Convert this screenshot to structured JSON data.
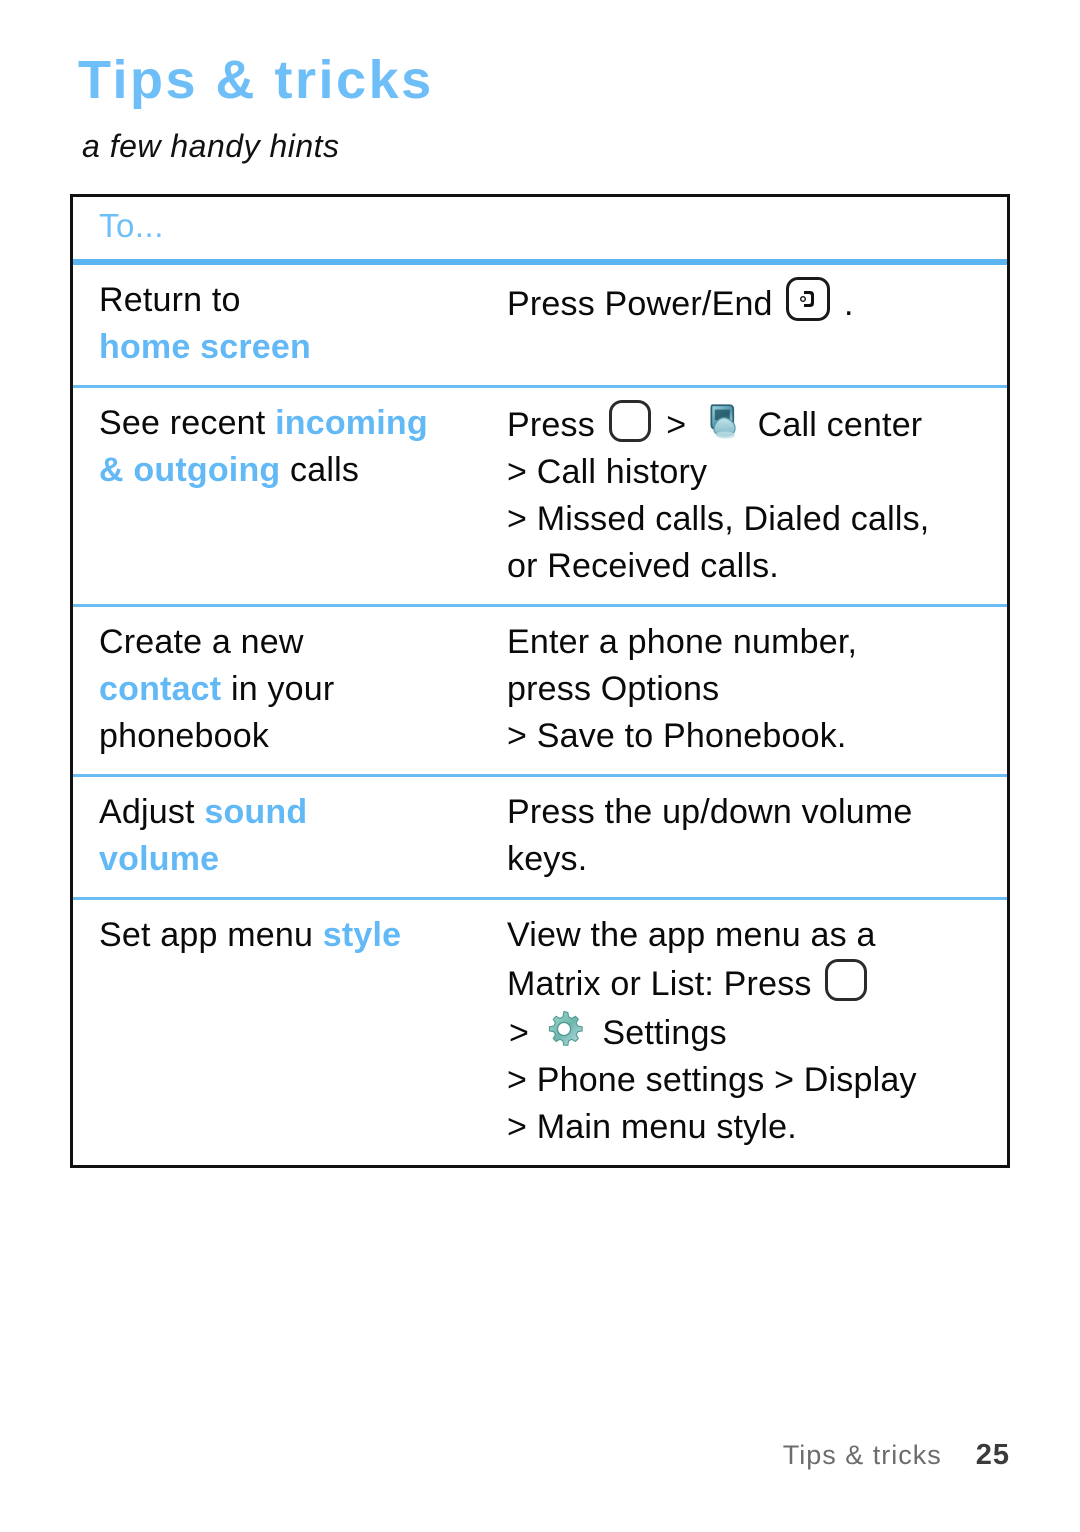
{
  "header": {
    "title": "Tips & tricks",
    "subtitle": "a few handy hints"
  },
  "table": {
    "column_header": "To...",
    "rows": [
      {
        "task": {
          "prefix": "Return to",
          "highlight": "home screen",
          "suffix": ""
        },
        "steps": [
          {
            "pre": "Press Power/End",
            "icon": "power-end-key-icon",
            "post": "."
          }
        ]
      },
      {
        "task": {
          "prefix": "See recent",
          "highlight": "incoming & outgoing",
          "suffix": "calls"
        },
        "steps": [
          {
            "pre": "Press",
            "icon": "center-select-key-icon",
            "mid": ">",
            "icon2": "call-center-icon",
            "post": "Call center"
          },
          {
            "pre": "> Call history"
          },
          {
            "pre": "> Missed calls, Dialed calls,"
          },
          {
            "pre": "or Received calls."
          }
        ]
      },
      {
        "task": {
          "prefix": "Create a new",
          "highlight": "contact",
          "suffix": "in your phonebook"
        },
        "steps": [
          {
            "pre": "Enter a phone number,"
          },
          {
            "pre": "press Options"
          },
          {
            "pre": "> Save to Phonebook."
          }
        ]
      },
      {
        "task": {
          "prefix": "Adjust",
          "highlight": "sound volume",
          "suffix": ""
        },
        "steps": [
          {
            "pre": "Press the up/down volume"
          },
          {
            "pre": "keys."
          }
        ]
      },
      {
        "task": {
          "prefix": "Set app menu",
          "highlight": "style",
          "suffix": ""
        },
        "steps": [
          {
            "pre": "View the app menu as a"
          },
          {
            "pre": "Matrix or List: Press",
            "icon": "center-select-key-icon"
          },
          {
            "pre": ">",
            "icon": "settings-gear-icon",
            "post": "Settings"
          },
          {
            "pre": "> Phone settings > Display"
          },
          {
            "pre": "> Main menu style."
          }
        ]
      }
    ]
  },
  "footer": {
    "section": "Tips & tricks",
    "page_number": "25"
  },
  "colors": {
    "accent_blue": "#62b9f6",
    "title_blue": "#6ebef7",
    "rule_blue": "#5bb5f0",
    "text_black": "#0a0a0a",
    "footer_gray": "#6c6c6c"
  },
  "text_fragments": {
    "row1_task_line1": "Return to",
    "row1_task_line2": "home screen",
    "row1_step1_pre": "Press Power/End",
    "row1_step1_post": ".",
    "row2_task_line1_pre": "See recent",
    "row2_task_line1_hl": "incoming",
    "row2_task_line2_hl": "& outgoing",
    "row2_task_line2_post": "calls",
    "row2_step1_pre": "Press",
    "row2_step1_gt": ">",
    "row2_step1_post": "Call center",
    "row2_step2": "> Call history",
    "row2_step3": "> Missed calls, Dialed calls,",
    "row2_step4": "or Received calls.",
    "row3_task_line1": "Create a new",
    "row3_task_line2_hl": "contact",
    "row3_task_line2_post": "in your",
    "row3_task_line3": "phonebook",
    "row3_step1": "Enter a phone number,",
    "row3_step2": "press Options",
    "row3_step3": "> Save to Phonebook.",
    "row4_task_line1_pre": "Adjust",
    "row4_task_line1_hl": "sound",
    "row4_task_line2_hl": "volume",
    "row4_step1": "Press the up/down volume",
    "row4_step2": "keys.",
    "row5_task_pre": "Set app menu",
    "row5_task_hl": "style",
    "row5_step1": "View the app menu as a",
    "row5_step2_pre": "Matrix or List: Press",
    "row5_step3_gt": ">",
    "row5_step3_post": "Settings",
    "row5_step4": "> Phone settings > Display",
    "row5_step5": "> Main menu style."
  }
}
